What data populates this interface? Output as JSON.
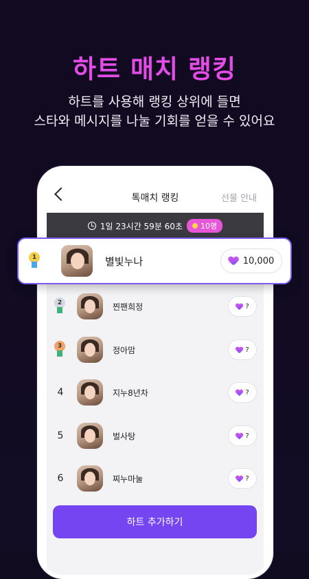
{
  "headline": "하트 매치 랭킹",
  "subtitle_line1": "하트를 사용해 랭킹 상위에 들면",
  "subtitle_line2": "스타와 메시지를 나눌 기회를 얻을 수 있어요",
  "phone": {
    "title": "톡매치 랭킹",
    "gift_link": "선물 안내",
    "timer_text": "1일 23시간 59분 60초",
    "count_badge": "10명"
  },
  "top_rank": {
    "rank": "1",
    "name": "별빛누나",
    "hearts": "10,000"
  },
  "rankings": [
    {
      "rank": "2",
      "name": "찐팬희정",
      "hearts": "?"
    },
    {
      "rank": "3",
      "name": "정아맘",
      "hearts": "?"
    },
    {
      "rank": "4",
      "name": "지누8년차",
      "hearts": "?"
    },
    {
      "rank": "5",
      "name": "벌사탕",
      "hearts": "?"
    },
    {
      "rank": "6",
      "name": "찌누마눌",
      "hearts": "?"
    }
  ],
  "cta_label": "하트 추가하기",
  "colors": {
    "headline": "#e44ce8",
    "accent": "#7445f0",
    "badge": "#e756d8",
    "background": "#110a20"
  },
  "icons": [
    "back-arrow-icon",
    "clock-icon",
    "heart-icon",
    "gold-medal-icon",
    "silver-medal-icon",
    "bronze-medal-icon"
  ]
}
